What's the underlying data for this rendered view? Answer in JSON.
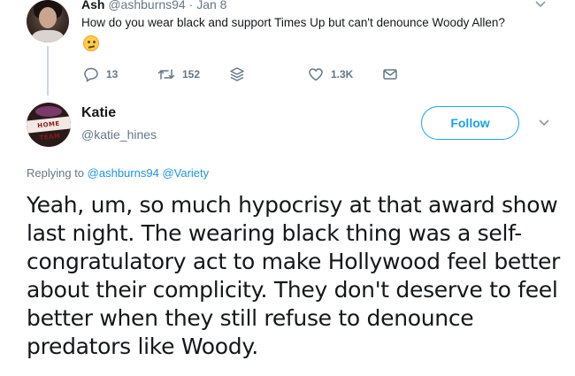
{
  "parent_tweet": {
    "name": "Ash",
    "handle": "@ashburns94",
    "separator": "·",
    "date": "Jan 8",
    "text": "How do you wear black and support Times Up but can't denounce Woody Allen?",
    "emoji_icon": "thinking-face-icon",
    "actions": {
      "reply_count": "13",
      "retweet_count": "152",
      "like_count": "1.3K"
    }
  },
  "reply_tweet": {
    "name": "Katie",
    "handle": "@katie_hines",
    "avatar_text": "HOME TEAM",
    "follow_label": "Follow",
    "replying_prefix": "Replying to",
    "replying_mentions": [
      "@ashburns94",
      "@Variety"
    ],
    "text": "Yeah, um, so much hypocrisy at that award show last night. The wearing black thing was a self-congratulatory act to make Hollywood feel better about their complicity. They don't deserve to feel better when they still refuse to denounce predators like Woody."
  },
  "colors": {
    "accent": "#1da1f2",
    "mention": "#1b95e0",
    "muted": "#657786",
    "text": "#14171a",
    "thread_line": "#ccd6dd"
  }
}
